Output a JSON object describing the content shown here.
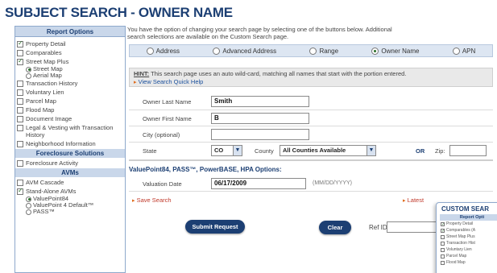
{
  "page_title": "SUBJECT SEARCH - OWNER NAME",
  "sidebar": {
    "header": "Report Options",
    "items": [
      {
        "label": "Property Detail",
        "checked": true
      },
      {
        "label": "Comparables",
        "checked": false
      },
      {
        "label": "Street Map Plus",
        "checked": true
      },
      {
        "label": "Transaction History",
        "checked": false
      },
      {
        "label": "Voluntary Lien",
        "checked": false
      },
      {
        "label": "Parcel Map",
        "checked": false
      },
      {
        "label": "Flood Map",
        "checked": false
      },
      {
        "label": "Document Image",
        "checked": false
      },
      {
        "label": "Legal & Vesting with Transaction History",
        "checked": false
      },
      {
        "label": "Neighborhood Information",
        "checked": false
      }
    ],
    "map_options": [
      {
        "label": "Street Map",
        "selected": true
      },
      {
        "label": "Aerial Map",
        "selected": false
      }
    ],
    "section_foreclosure": "Foreclosure Solutions",
    "foreclosure_items": [
      {
        "label": "Foreclosure Activity",
        "checked": false
      }
    ],
    "section_avms": "AVMs",
    "avm_items": [
      {
        "label": "AVM Cascade",
        "checked": false
      },
      {
        "label": "Stand-Alone AVMs",
        "checked": true
      }
    ],
    "avm_options": [
      {
        "label": "ValuePoint84",
        "selected": true
      },
      {
        "label": "ValuePoint 4 Default™",
        "selected": false
      },
      {
        "label": "PASS™",
        "selected": false
      }
    ]
  },
  "intro_text_line1": "You have the option of changing your search page by selecting one of the buttons below. Additional",
  "intro_text_line2": "search selections are available on the Custom Search page.",
  "search_types": [
    {
      "label": "Address",
      "selected": false
    },
    {
      "label": "Advanced Address",
      "selected": false
    },
    {
      "label": "Range",
      "selected": false
    },
    {
      "label": "Owner Name",
      "selected": true
    },
    {
      "label": "APN",
      "selected": false
    }
  ],
  "hint": {
    "label": "HINT:",
    "text": " This search page uses an auto wild-card, matching all names that start with the portion entered.",
    "link": "View Search Quick Help"
  },
  "form": {
    "last_name_label": "Owner Last Name",
    "last_name_value": "Smith",
    "first_name_label": "Owner First Name",
    "first_name_value": "B",
    "city_label": "City (optional)",
    "city_value": "",
    "state_label": "State",
    "state_value": "CO",
    "county_label": "County",
    "county_value": "All Counties Available",
    "or_label": "OR",
    "zip_label": "Zip:",
    "zip_value": ""
  },
  "valuepoint": {
    "title": "ValuePoint84, PASS™, PowerBASE, HPA Options:",
    "date_label": "Valuation Date",
    "date_value": "06/17/2009",
    "date_hint": "(MM/DD/YYYY)"
  },
  "links": {
    "save_search": "Save Search",
    "latest": "Latest"
  },
  "buttons": {
    "submit": "Submit Request",
    "clear": "Clear"
  },
  "ref_id_label": "Ref ID",
  "ref_id_value": "",
  "custom_search": {
    "title": "CUSTOM SEAR",
    "header": "Report Opti",
    "items": [
      {
        "label": "Property Detail",
        "checked": true
      },
      {
        "label": "Comparables (A",
        "checked": true
      },
      {
        "label": "Street Map Plus",
        "checked": false
      },
      {
        "label": "Transaction Hist",
        "checked": false
      },
      {
        "label": "Voluntary Lien",
        "checked": false
      },
      {
        "label": "Parcel Map",
        "checked": false
      },
      {
        "label": "Flood Map",
        "checked": false
      }
    ]
  },
  "colors": {
    "brand_navy": "#1c3f73",
    "section_blue": "#c9d7ea",
    "link_red": "#c0392b",
    "link_blue": "#1a4f9c"
  }
}
